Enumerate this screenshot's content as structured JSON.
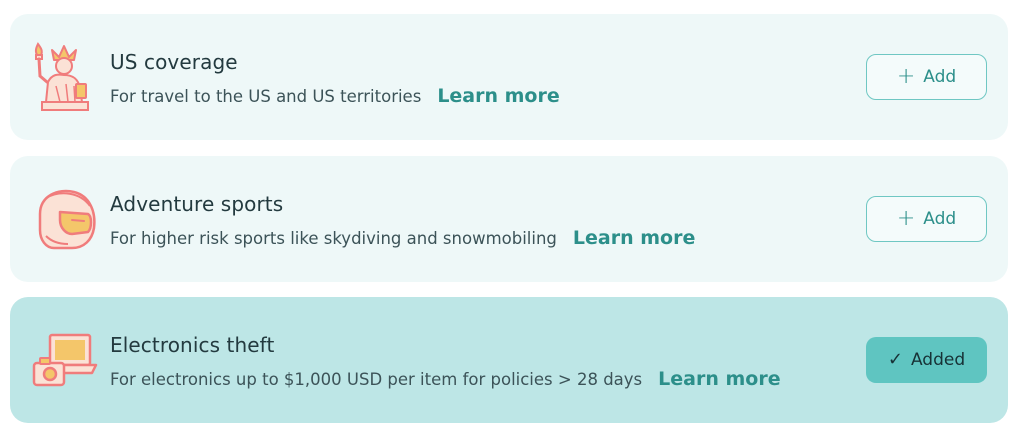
{
  "cards": [
    {
      "title": "US coverage",
      "description": "For travel to the US and US territories",
      "learn_more": "Learn more",
      "icon": "statue-of-liberty-icon",
      "button": {
        "label": "Add",
        "glyph": "+",
        "state": "add"
      }
    },
    {
      "title": "Adventure sports",
      "description": "For higher risk sports like skydiving and snowmobiling",
      "learn_more": "Learn more",
      "icon": "helmet-icon",
      "button": {
        "label": "Add",
        "glyph": "+",
        "state": "add"
      }
    },
    {
      "title": "Electronics theft",
      "description": "For electronics up to $1,000 USD per item for policies > 28 days",
      "learn_more": "Learn more",
      "icon": "laptop-camera-icon",
      "button": {
        "label": "Added",
        "glyph": "✓",
        "state": "added"
      }
    }
  ],
  "colors": {
    "card_bg": "#eef8f8",
    "card_selected_bg": "#bde6e6",
    "accent": "#2c8f8a",
    "button_added_bg": "#5fc5c1",
    "icon_coral": "#f07c7c",
    "icon_yellow": "#f4c66a"
  }
}
